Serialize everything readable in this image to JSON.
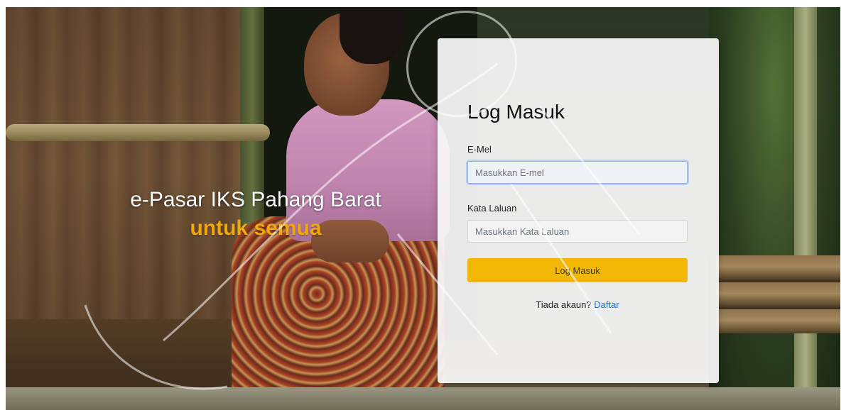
{
  "hero": {
    "title": "e-Pasar IKS Pahang Barat",
    "subtitle": "untuk semua"
  },
  "login": {
    "heading": "Log Masuk",
    "email_label": "E-Mel",
    "email_placeholder": "Masukkan E-mel",
    "password_label": "Kata Laluan",
    "password_placeholder": "Masukkan Kata Laluan",
    "submit_label": "Log Masuk",
    "signup_prompt": "Tiada akaun?",
    "signup_link": "Daftar"
  },
  "colors": {
    "accent": "#f2b705",
    "subtitle": "#f0a80a",
    "link": "#1a73e8"
  }
}
